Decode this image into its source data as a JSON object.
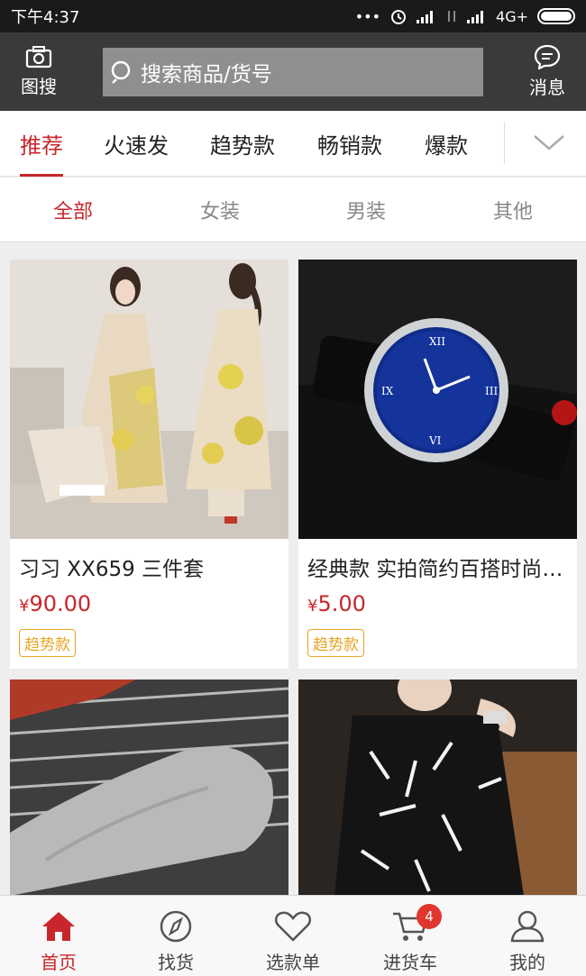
{
  "status_bar": {
    "time": "下午4:37",
    "network": "4G+"
  },
  "header": {
    "image_search_label": "图搜",
    "search_placeholder": "搜索商品/货号",
    "messages_label": "消息"
  },
  "category_tabs": [
    {
      "label": "推荐",
      "active": true
    },
    {
      "label": "火速发",
      "active": false
    },
    {
      "label": "趋势款",
      "active": false
    },
    {
      "label": "畅销款",
      "active": false
    },
    {
      "label": "爆款",
      "active": false
    }
  ],
  "sub_tabs": [
    {
      "label": "全部",
      "active": true
    },
    {
      "label": "女装",
      "active": false
    },
    {
      "label": "男装",
      "active": false
    },
    {
      "label": "其他",
      "active": false
    }
  ],
  "products": [
    {
      "title": "习习 XX659 三件套",
      "currency": "¥",
      "price": "90.00",
      "tag": "趋势款",
      "image": "floral-dress-photo"
    },
    {
      "title": "经典款 实拍简约百搭时尚手表",
      "currency": "¥",
      "price": "5.00",
      "tag": "趋势款",
      "image": "blue-dial-watch-photo"
    },
    {
      "title": "",
      "image": "grey-socks-photo"
    },
    {
      "title": "",
      "image": "black-sweater-photo"
    }
  ],
  "bottom_nav": [
    {
      "label": "首页",
      "icon": "home-icon",
      "active": true
    },
    {
      "label": "找货",
      "icon": "compass-icon",
      "active": false
    },
    {
      "label": "选款单",
      "icon": "heart-icon",
      "active": false
    },
    {
      "label": "进货车",
      "icon": "cart-icon",
      "active": false,
      "badge": "4"
    },
    {
      "label": "我的",
      "icon": "user-icon",
      "active": false
    }
  ],
  "colors": {
    "accent": "#c8262c",
    "tag": "#e8a425",
    "header_bg": "#3a3a3a",
    "badge": "#e0362f"
  }
}
